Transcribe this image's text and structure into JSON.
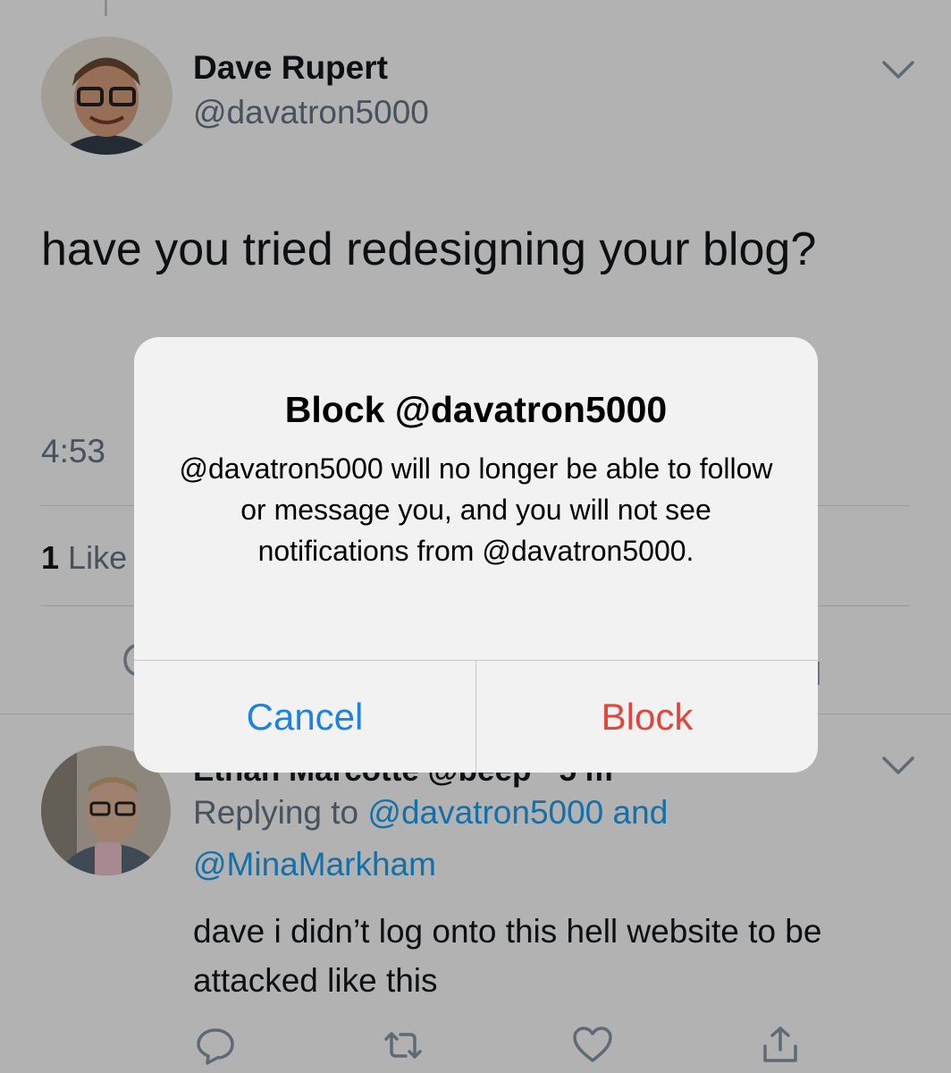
{
  "tweet": {
    "author_name": "Dave Rupert",
    "author_handle": "@davatron5000",
    "text": "have you tried redesigning your blog?",
    "time": "4:53",
    "likes_count": "1",
    "likes_label": "Like"
  },
  "reply": {
    "author_name": "Ethan Marcotte @beep · 5 m",
    "replying_prefix": "Replying to",
    "mention_1": "@davatron5000",
    "conj": "and",
    "mention_2": "@MinaMarkham",
    "text": "dave i didn’t log onto this hell website to be attacked like this"
  },
  "icons": {
    "tweet_menu": "chevron-down-icon",
    "reply_menu": "chevron-down-icon",
    "actions": [
      "reply-icon",
      "retweet-icon",
      "like-icon",
      "share-icon"
    ]
  },
  "alert": {
    "title": "Block @davatron5000",
    "message": "@davatron5000 will no longer be able to follow or message you, and you will not see notifications from @davatron5000.",
    "cancel_label": "Cancel",
    "block_label": "Block"
  },
  "colors": {
    "link": "#1da1f2",
    "secondary_text": "#657786",
    "alert_cancel": "#1a82e3",
    "alert_destructive": "#e2453c",
    "alert_background": "#f2f2f2"
  }
}
